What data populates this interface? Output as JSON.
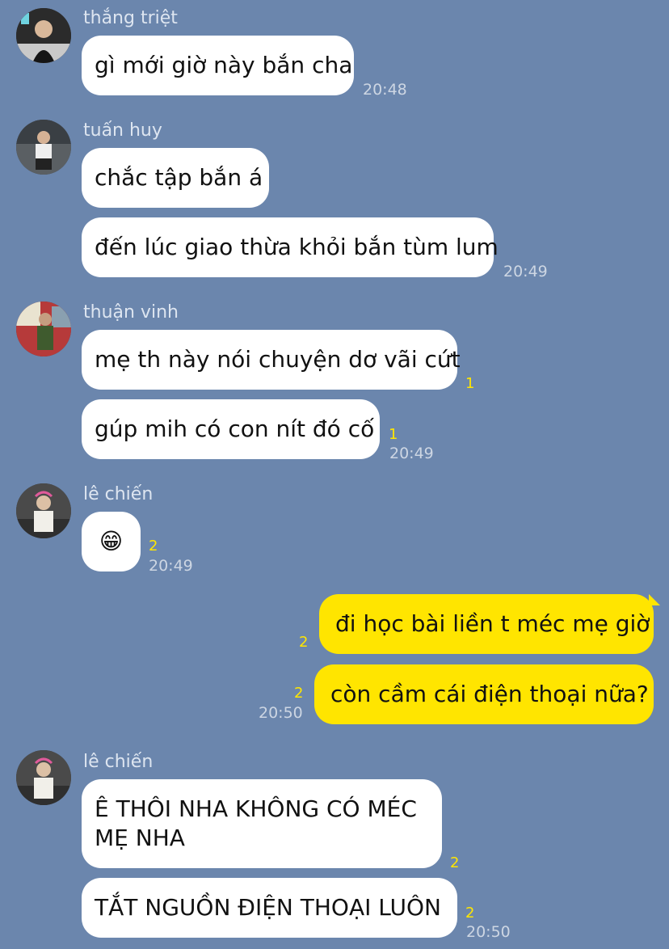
{
  "messages": [
    {
      "sender": "thắng triệt",
      "text": "gì mới giờ này bắn cha",
      "time": "20:48"
    },
    {
      "sender": "tuấn huy",
      "text": "chắc tập bắn á"
    },
    {
      "text": "đến lúc giao thừa khỏi bắn tùm lum",
      "time": "20:49"
    },
    {
      "sender": "thuận vinh",
      "text": "mẹ th này nói chuyện dơ vãi cứt",
      "unread": "1"
    },
    {
      "text": "gúp mih có con nít đó cố",
      "unread": "1",
      "time": "20:49"
    },
    {
      "sender": "lê chiến",
      "text": "😁",
      "unread": "2",
      "time": "20:49"
    },
    {
      "text": "đi học bài liền t méc mẹ giờ",
      "unread": "2",
      "mine": true
    },
    {
      "text": "còn cầm cái điện thoại nữa?",
      "unread": "2",
      "time": "20:50",
      "mine": true
    },
    {
      "sender": "lê chiến",
      "text": "Ê THÔI NHA KHÔNG CÓ MÉC MẸ NHA",
      "unread": "2"
    },
    {
      "text": "TẮT NGUỒN ĐIỆN THOẠI LUÔN",
      "unread": "2",
      "time": "20:50"
    }
  ],
  "colors": {
    "background": "#6b86ad",
    "incoming": "#ffffff",
    "outgoing": "#ffe500",
    "unread": "#ffe600"
  }
}
